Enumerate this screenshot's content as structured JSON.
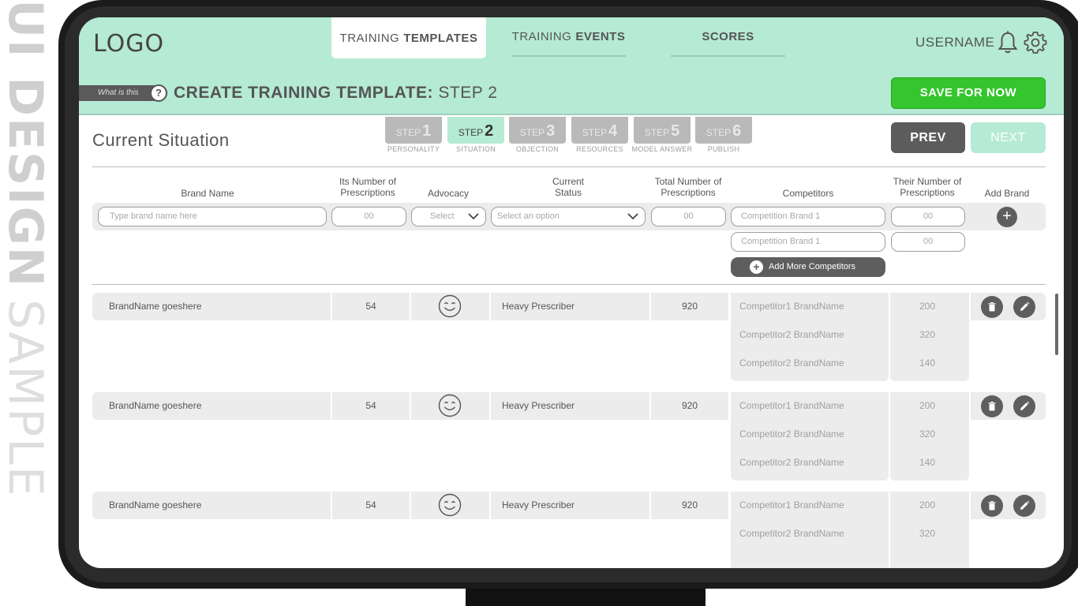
{
  "watermark": {
    "bold": "UI DESIGN",
    "light": "SAMPLE"
  },
  "header": {
    "logo": "LOGO",
    "tabs": [
      {
        "light": "TRAINING",
        "bold": "TEMPLATES"
      },
      {
        "light": "TRAINING",
        "bold": "EVENTS"
      },
      {
        "light": "",
        "bold": "SCORES"
      }
    ],
    "username": "USERNAME",
    "whatis": "What is this",
    "help": "?",
    "heading_bold": "CREATE TRAINING TEMPLATE:",
    "heading_light": "STEP 2",
    "save_label": "SAVE FOR NOW"
  },
  "section": {
    "title": "Current Situation",
    "steps": [
      {
        "label": "STEP",
        "num": "1",
        "caption": "PERSONALITY"
      },
      {
        "label": "STEP",
        "num": "2",
        "caption": "SITUATION"
      },
      {
        "label": "STEP",
        "num": "3",
        "caption": "OBJECTION"
      },
      {
        "label": "STEP",
        "num": "4",
        "caption": "RESOURCES"
      },
      {
        "label": "STEP",
        "num": "5",
        "caption": "MODEL ANSWER"
      },
      {
        "label": "STEP",
        "num": "6",
        "caption": "PUBLISH"
      }
    ],
    "prev_label": "PREV",
    "next_label": "NEXT"
  },
  "columns": {
    "brand_name": "Brand Name",
    "its_number_1": "Its Number of",
    "its_number_2": "Prescriptions",
    "advocacy": "Advocacy",
    "current_1": "Current",
    "current_2": "Status",
    "total_1": "Total Number of",
    "total_2": "Prescriptions",
    "competitors": "Competitors",
    "their_1": "Their Number of",
    "their_2": "Prescriptions",
    "add_brand": "Add Brand"
  },
  "form": {
    "brand_placeholder": "Type brand name here",
    "its_number": "00",
    "advocacy_select": "Select",
    "status_select": "Select an option",
    "total_number": "00",
    "competitor_1": "Competition Brand 1",
    "competitor_1_number": "00",
    "competitor_2": "Competition Brand 1",
    "competitor_2_number": "00",
    "add_more_label": "Add More Competitors",
    "add_icon": "+"
  },
  "rows": [
    {
      "brand": "BrandName goeshere",
      "its_number": "54",
      "status": "Heavy Prescriber",
      "total": "920",
      "competitors": [
        {
          "name": "Competitor1 BrandName",
          "number": "200"
        },
        {
          "name": "Competitor2 BrandName",
          "number": "320"
        },
        {
          "name": "Competitor2 BrandName",
          "number": "140"
        }
      ]
    },
    {
      "brand": "BrandName goeshere",
      "its_number": "54",
      "status": "Heavy Prescriber",
      "total": "920",
      "competitors": [
        {
          "name": "Competitor1 BrandName",
          "number": "200"
        },
        {
          "name": "Competitor2 BrandName",
          "number": "320"
        },
        {
          "name": "Competitor2 BrandName",
          "number": "140"
        }
      ]
    },
    {
      "brand": "BrandName goeshere",
      "its_number": "54",
      "status": "Heavy Prescriber",
      "total": "920",
      "competitors": [
        {
          "name": "Competitor1 BrandName",
          "number": "200"
        },
        {
          "name": "Competitor2 BrandName",
          "number": "320"
        }
      ]
    }
  ],
  "colors": {
    "header_bg": "#b5ead5",
    "save_green": "#35c52e",
    "dark_button": "#5c5c5c",
    "row_bg": "#ececec"
  }
}
